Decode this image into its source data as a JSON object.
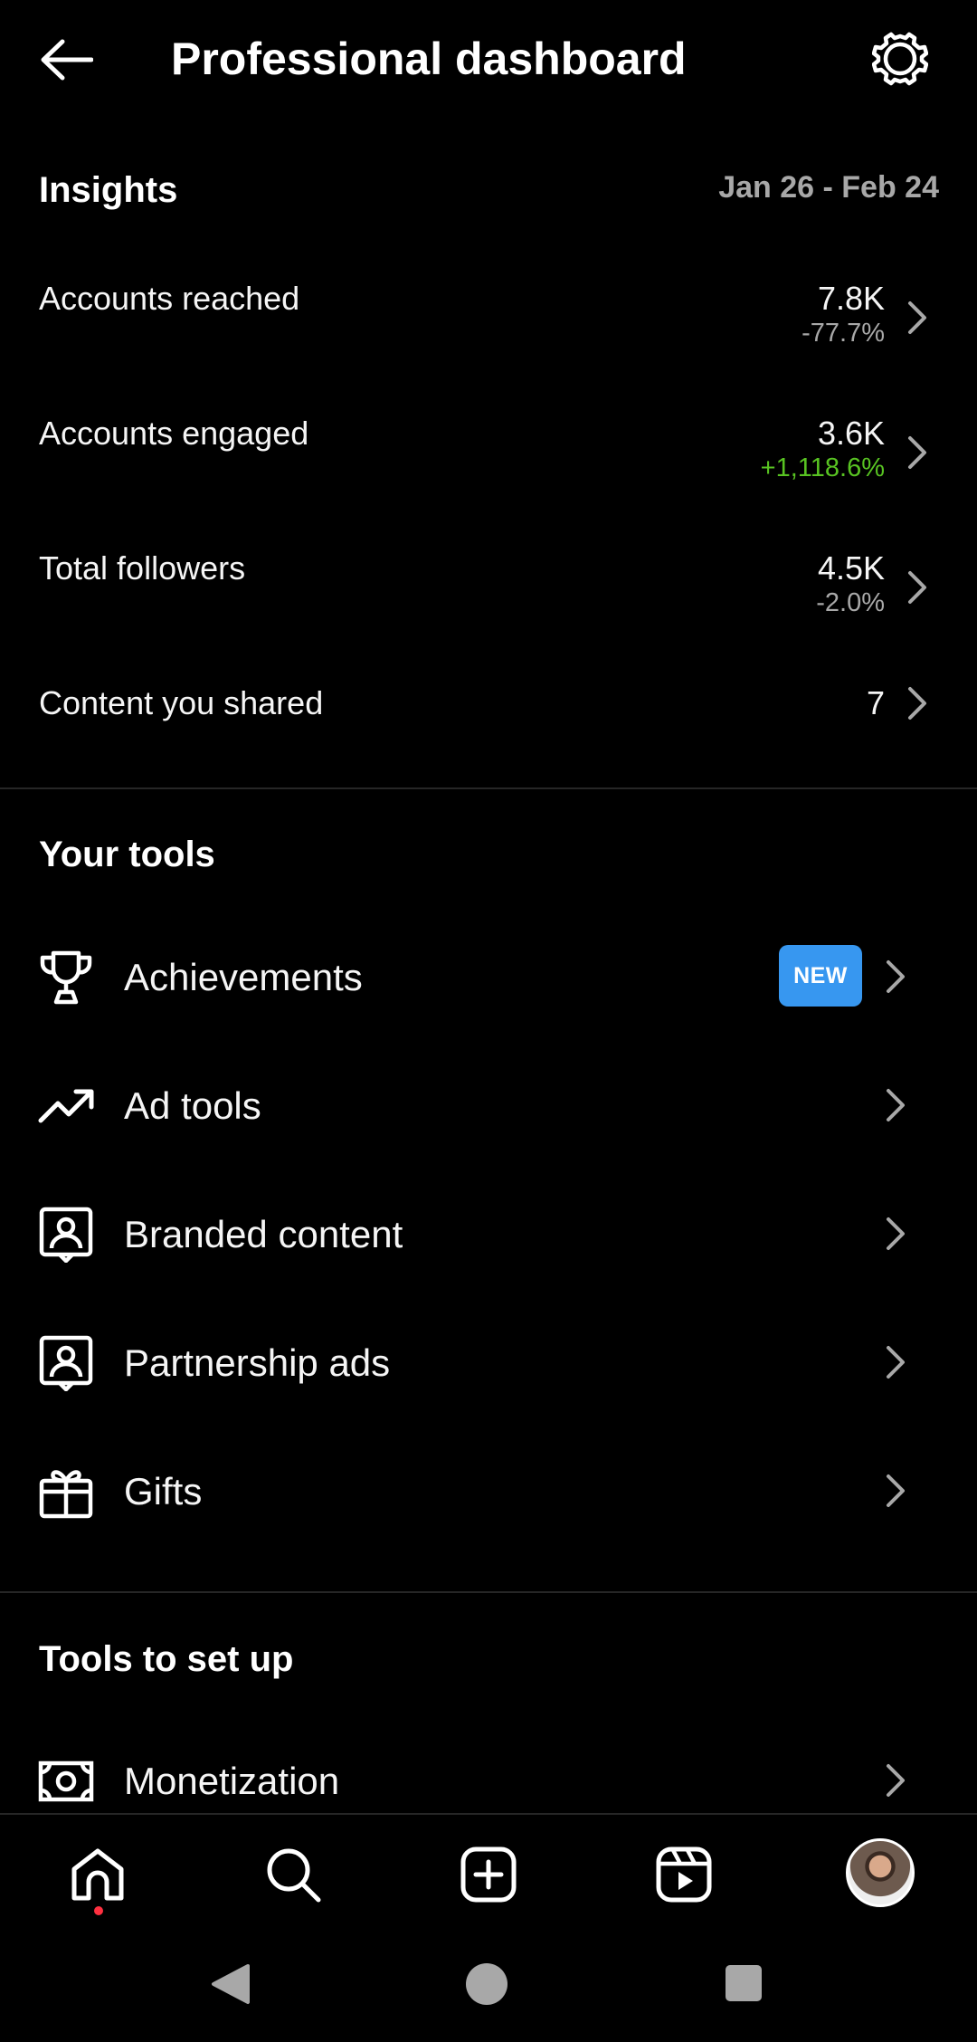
{
  "header": {
    "title": "Professional dashboard"
  },
  "insights": {
    "title": "Insights",
    "date_range": "Jan 26 - Feb 24",
    "metrics": [
      {
        "label": "Accounts reached",
        "value": "7.8K",
        "change": "-77.7%"
      },
      {
        "label": "Accounts engaged",
        "value": "3.6K",
        "change": "+1,118.6%"
      },
      {
        "label": "Total followers",
        "value": "4.5K",
        "change": "-2.0%"
      },
      {
        "label": "Content you shared",
        "value": "7"
      }
    ]
  },
  "tools": {
    "title": "Your tools",
    "items": [
      {
        "label": "Achievements",
        "icon": "trophy-icon",
        "badge": "NEW"
      },
      {
        "label": "Ad tools",
        "icon": "trending-up-icon"
      },
      {
        "label": "Branded content",
        "icon": "branded-content-icon"
      },
      {
        "label": "Partnership ads",
        "icon": "partnership-ads-icon"
      },
      {
        "label": "Gifts",
        "icon": "gift-icon"
      }
    ]
  },
  "setup": {
    "title": "Tools to set up",
    "items": [
      {
        "label": "Monetization",
        "icon": "money-icon"
      }
    ]
  },
  "bottom_nav": {
    "items": [
      "home-icon",
      "search-icon",
      "create-icon",
      "reels-icon",
      "profile-avatar"
    ]
  },
  "colors": {
    "background": "#000000",
    "positive_change": "#58c322",
    "badge": "#3797f0",
    "muted_text": "#a8a8a8"
  }
}
